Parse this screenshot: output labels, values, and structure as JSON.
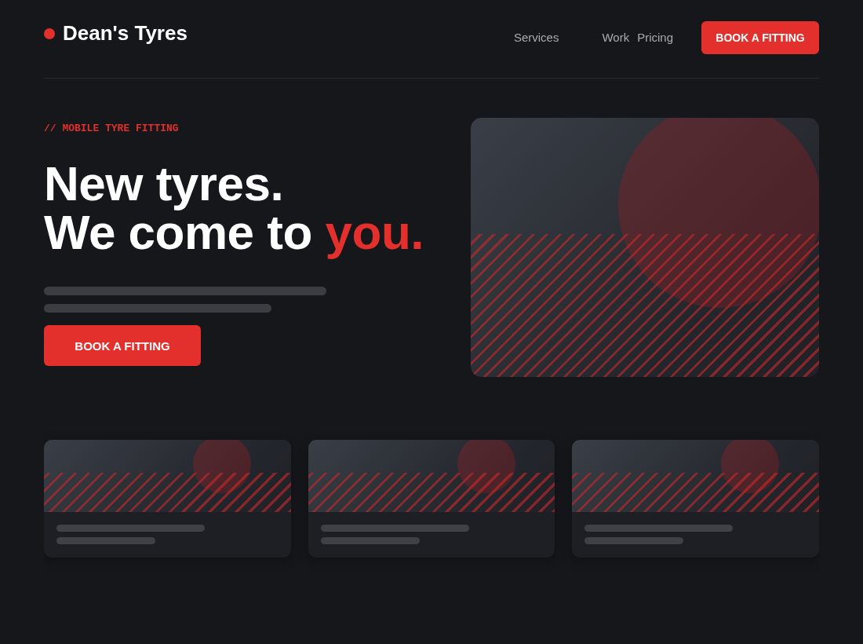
{
  "brand": {
    "name": "Dean's Tyres"
  },
  "nav": {
    "links": [
      "Services",
      "Work",
      "Pricing"
    ],
    "cta": "BOOK A FITTING"
  },
  "hero": {
    "eyebrow": "// MOBILE TYRE FITTING",
    "headline_line_1": "New tyres.",
    "headline_line_2": "We come to",
    "headline_accent": "you.",
    "cta": "BOOK A FITTING"
  }
}
